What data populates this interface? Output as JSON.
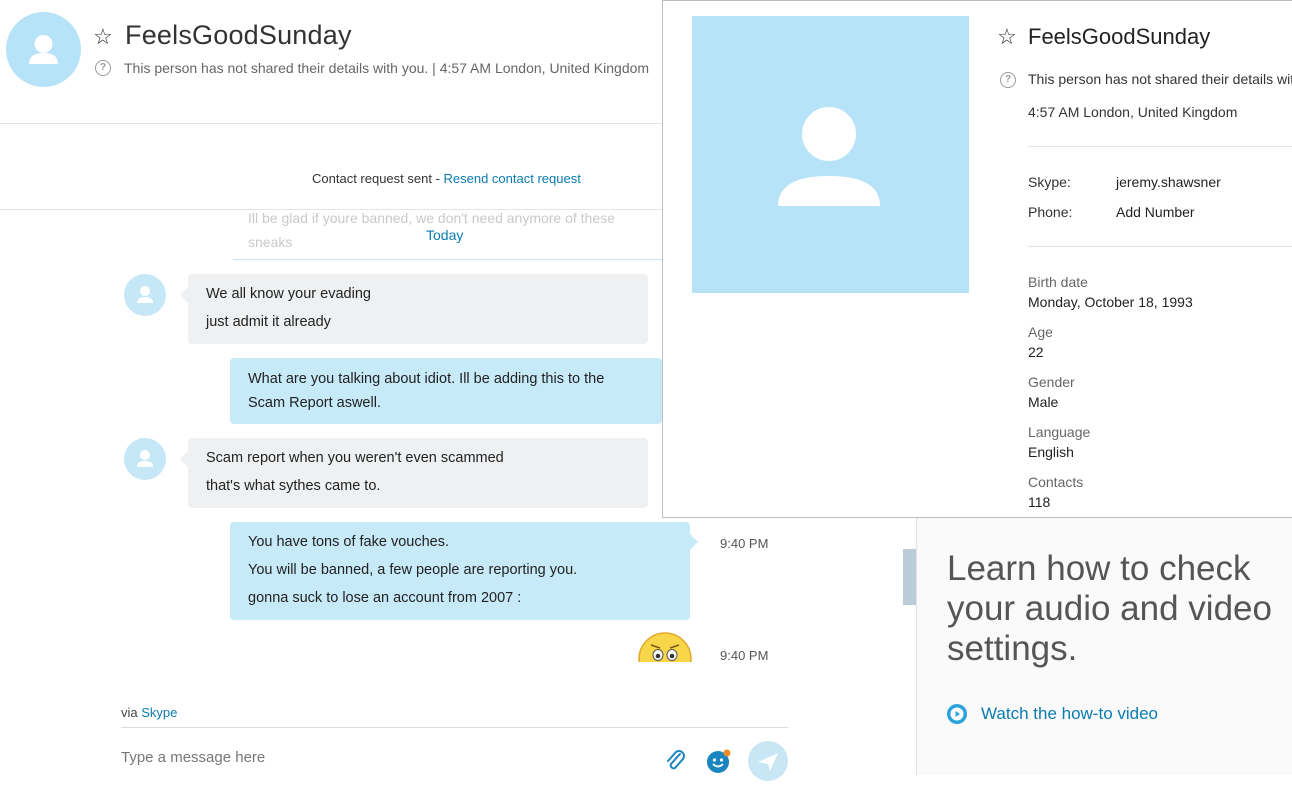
{
  "conversation": {
    "contact_name": "FeelsGoodSunday",
    "subtitle": "This person has not shared their details with you.  |  4:57 AM London, United Kingdom",
    "request_text": "Contact request sent - ",
    "request_link": "Resend contact request",
    "ghost_text": "Ill be glad if youre banned, we don't need anymore of these sneaks",
    "day_divider": "Today",
    "messages": [
      {
        "direction": "in",
        "lines": [
          "We all know your evading",
          "just admit it already"
        ]
      },
      {
        "direction": "out",
        "lines": [
          "What are you talking about idiot. Ill be adding this to the",
          "Scam Report aswell."
        ]
      },
      {
        "direction": "in",
        "lines": [
          "Scam report when you weren't even scammed",
          "that's what sythes came to."
        ]
      },
      {
        "direction": "out",
        "lines": [
          "You have tons of fake vouches.",
          "You will be banned, a few people are reporting you.",
          "gonna suck to lose an account from 2007 :"
        ],
        "time": "9:40 PM"
      },
      {
        "direction": "out",
        "emoticon": "worried-emoticon",
        "time": "9:40 PM"
      }
    ],
    "via_prefix": "via ",
    "via_link": "Skype",
    "compose_placeholder": "Type a message here"
  },
  "profile": {
    "name": "FeelsGoodSunday",
    "notice": "This person has not shared their details with you.",
    "location": "4:57 AM London, United Kingdom",
    "skype_label": "Skype:",
    "skype_value": "jeremy.shawsner",
    "phone_label": "Phone:",
    "phone_value": "Add Number",
    "fields": [
      {
        "label": "Birth date",
        "value": "Monday, October 18, 1993"
      },
      {
        "label": "Age",
        "value": "22"
      },
      {
        "label": "Gender",
        "value": "Male"
      },
      {
        "label": "Language",
        "value": "English"
      },
      {
        "label": "Contacts",
        "value": "118"
      }
    ]
  },
  "promo": {
    "title": "Learn how to check your audio and video settings.",
    "link": "Watch the how-to video"
  },
  "icons": [
    "star-icon",
    "help-icon",
    "avatar-icon",
    "attach-icon",
    "emoticon-icon",
    "send-icon",
    "play-icon"
  ],
  "colors": {
    "accent": "#0a7cb0",
    "avatar_bg": "#b7e3f8",
    "outgoing_bubble": "#c7eaf9",
    "incoming_bubble": "#eef0f2"
  }
}
